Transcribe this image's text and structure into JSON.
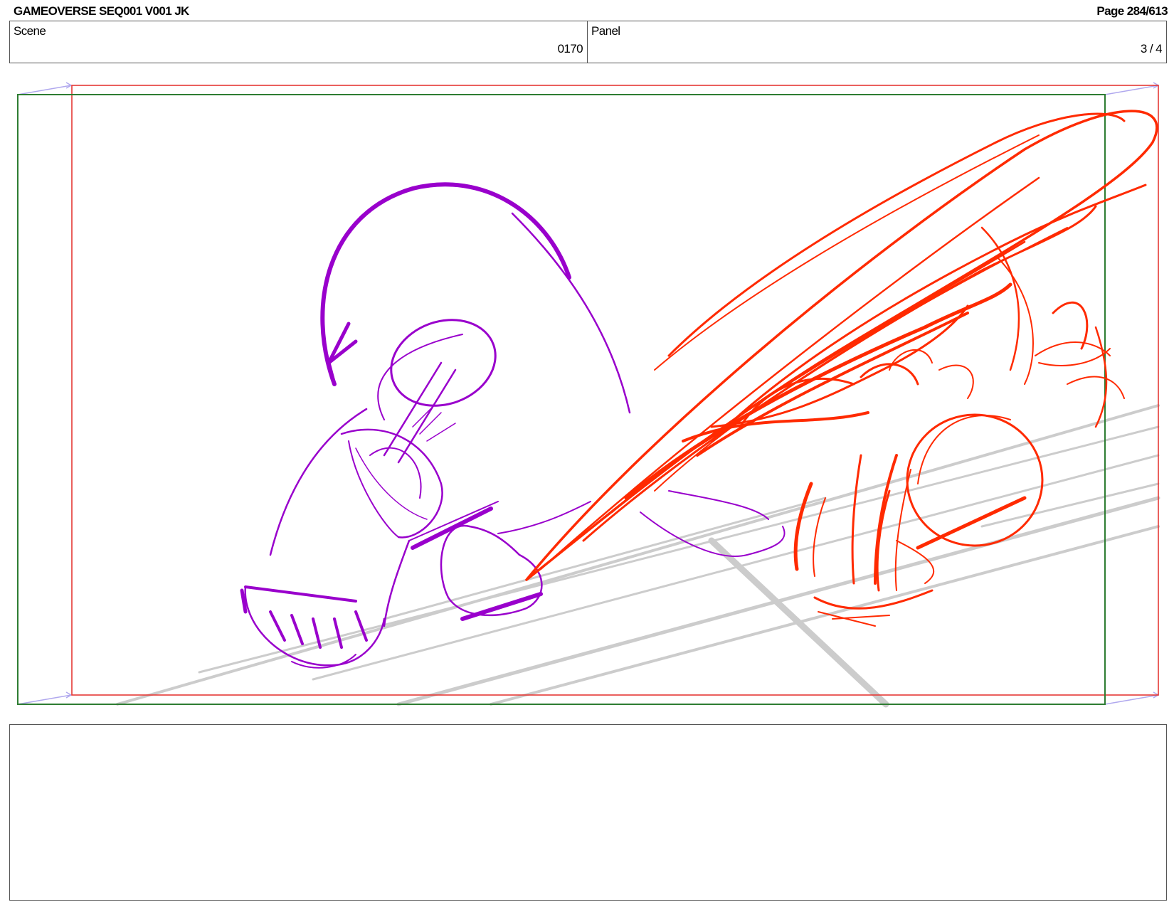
{
  "header": {
    "title": "GAMEOVERSE SEQ001 V001 JK",
    "page": "Page 284/613"
  },
  "info": {
    "scene_label": "Scene",
    "scene_value": "0170",
    "panel_label": "Panel",
    "panel_value": "3 / 4"
  },
  "colors": {
    "camera_frame": "#2e7d32",
    "safe_frame": "#e53935",
    "sketch_purple": "#9900cc",
    "sketch_red": "#ff2a00",
    "guides": "#cccccc"
  },
  "notes": {
    "text": ""
  }
}
